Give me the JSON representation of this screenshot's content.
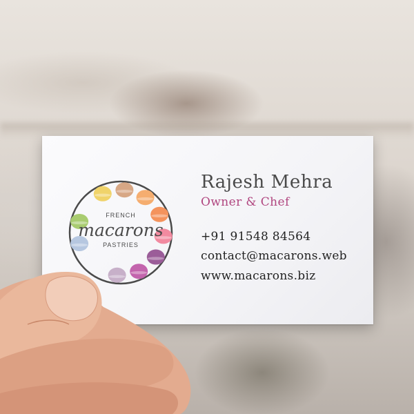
{
  "logo": {
    "top_text": "FRENCH",
    "main_text": "macarons",
    "bottom_text": "PASTRIES",
    "macaron_colors": [
      "#f0d36a",
      "#d7a785",
      "#f5ad6f",
      "#f4935d",
      "#f28aa0",
      "#9b5d99",
      "#c364ad",
      "#c7b0c9",
      "#b6c7e0",
      "#a9cc70"
    ]
  },
  "card": {
    "name": "Rajesh Mehra",
    "role": "Owner & Chef",
    "phone": "+91 91548 84564",
    "email": "contact@macarons.web",
    "website": "www.macarons.biz"
  },
  "colors": {
    "role_accent": "#b0457f",
    "card_bg": "#f6f6f8"
  }
}
